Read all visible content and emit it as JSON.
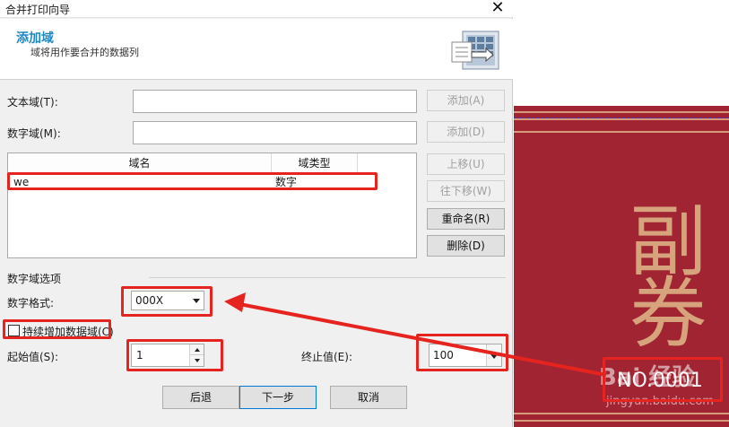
{
  "window": {
    "title": "合并打印向导"
  },
  "header": {
    "title": "添加域",
    "subtitle": "域将用作要合并的数据列"
  },
  "text_field": {
    "label": "文本域(T):",
    "value": "",
    "add_label": "添加(A)"
  },
  "number_field": {
    "label": "数字域(M):",
    "value": "",
    "add_label": "添加(D)"
  },
  "list": {
    "columns": [
      "域名",
      "域类型"
    ],
    "rows": [
      {
        "name": "we",
        "type": "数字"
      }
    ]
  },
  "side_buttons": {
    "move_up": "上移(U)",
    "move_down": "往下移(W)",
    "rename": "重命名(R)",
    "delete": "删除(D)"
  },
  "options": {
    "group_label": "数字域选项",
    "format_label": "数字格式:",
    "format_value": "000X",
    "continuous_label": "持续增加数据域(C)",
    "continuous_checked": false,
    "start_label": "起始值(S):",
    "start_value": "1",
    "end_label": "终止值(E):",
    "end_value": "100"
  },
  "footer": {
    "back": "后退",
    "next": "下一步",
    "cancel": "取消"
  },
  "preview": {
    "chars": [
      "副",
      "券"
    ],
    "serial": "NO.0001",
    "watermark": "Bai 经验",
    "watermark_url": "jingyan.baidu.com"
  },
  "colors": {
    "accent": "#1e88c7",
    "highlight": "#e5231f",
    "ticket": "#a12433",
    "ticket_text": "#d6a37d"
  }
}
